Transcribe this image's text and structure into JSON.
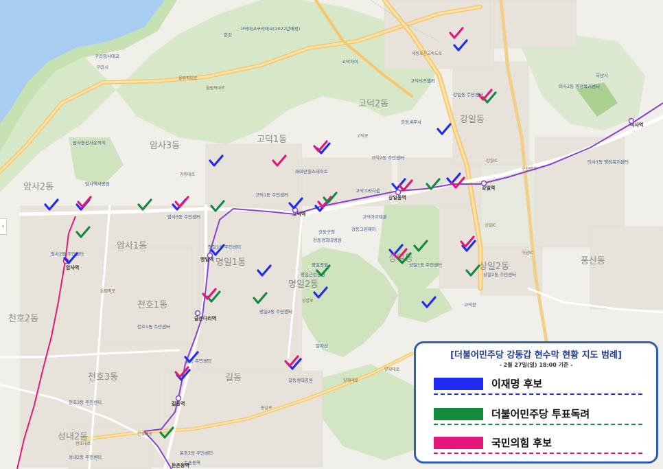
{
  "legend": {
    "title": "[더불어민주당 강동갑 현수막 현황 지도 범례]",
    "subtitle": "- 2월 27일(일) 18:00 기준 -",
    "items": [
      {
        "label": "이재명 후보",
        "color": "#1f2bf0"
      },
      {
        "label": "더불어민주당 투표독려",
        "color": "#138a3e"
      },
      {
        "label": "국민의힘 후보",
        "color": "#e5167a"
      }
    ]
  },
  "colors": {
    "lee": "#1f2bf0",
    "party": "#138a3e",
    "ppp": "#e5167a",
    "line5": "#8a3fd1",
    "line8": "#e2197a"
  },
  "map": {
    "dong_labels": [
      "고덕2동",
      "암사3동",
      "고덕1동",
      "암사2동",
      "명일1동",
      "명일2동",
      "암사1동",
      "천호2동",
      "천호1동",
      "천호3동",
      "길동",
      "성내2동",
      "상일동",
      "강일동",
      "풍산동",
      "상일2동"
    ],
    "stations": [
      "암사역",
      "굽은다리역",
      "명일역",
      "고덕역",
      "상일동역",
      "강일역",
      "길동역",
      "미사역",
      "둔촌동역"
    ],
    "poi_labels": [
      "고덕1동 주민센터",
      "암사3동 주민센터",
      "고덕2동 주민센터",
      "상일1동 주민센터",
      "명일1동 주민센터",
      "명일2동 주민센터",
      "천호1동 주민센터",
      "천호3동 주민센터",
      "길동 주민센터",
      "성내2동 주민센터",
      "둔촌2동 주민센터",
      "암사2동 주민센터",
      "상일2동 주민센터",
      "미사1동 행정복지센터",
      "미사2동 행정복지센터",
      "강일동 주민센터",
      "강동구청",
      "강동경희대병원",
      "명일공원",
      "강동그린웨이",
      "일자산",
      "고덕천",
      "고덕대교구리대교(2022년예정)",
      "구리암사대교",
      "올림픽대로",
      "천호대로",
      "양재대로",
      "강일IC",
      "상일IC",
      "하남IC",
      "고덕비즈밸리",
      "강동세무서",
      "암사동선사유적지",
      "둔촌동역",
      "암사역사공원",
      "고덕자이",
      "고덕아르테온",
      "고덕그라시움",
      "래미안힐스테이트",
      "명일근린공원",
      "길동생태공원",
      "구리시",
      "하남시",
      "한강"
    ],
    "road_labels": [
      "올림픽대로",
      "고덕로",
      "양재대로",
      "천호대로",
      "강동대로",
      "구천면로",
      "상암로",
      "동남로",
      "올림픽로",
      "세종포천고속도로"
    ]
  }
}
